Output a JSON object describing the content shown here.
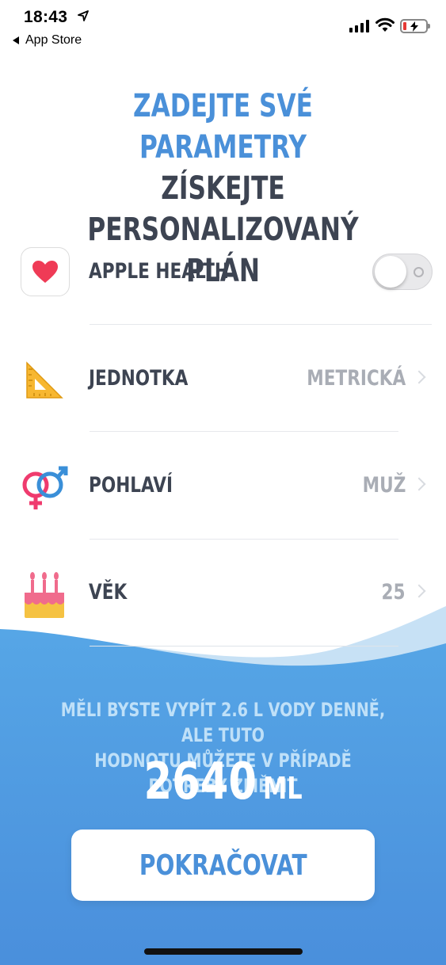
{
  "status_bar": {
    "time": "18:43",
    "back_label": "App Store",
    "icons": [
      "location-arrow-icon",
      "signal-icon",
      "wifi-icon",
      "battery-charging-icon"
    ]
  },
  "header": {
    "line1": "ZADEJTE SVÉ PARAMETRY",
    "line2": "ZÍSKEJTE PERSONALIZOVANÝ",
    "line3": "PLÁN"
  },
  "rows": [
    {
      "label": "APPLE HEALTH",
      "icon": "heart-icon",
      "toggle_on": false
    },
    {
      "label": "JEDNOTKA",
      "value": "METRICKÁ",
      "icon": "ruler-triangle-icon"
    },
    {
      "label": "POHLAVÍ",
      "value": "MUŽ",
      "icon": "gender-icon"
    },
    {
      "label": "VĚK",
      "value": "25",
      "icon": "cake-icon"
    }
  ],
  "recommendation": {
    "line1": "MĚLI BYSTE VYPÍT 2.6 L VODY DENNĚ, ALE TUTO",
    "line2": "HODNOTU MŮŽETE V PŘÍPADĚ POTŘEBY ZMĚNIT",
    "amount": "2640",
    "unit": "ML"
  },
  "cta": {
    "label": "POKRAČOVAT"
  },
  "colors": {
    "accent": "#4a90d9",
    "text": "#3d4452",
    "muted": "#a9adb5",
    "wave": "#4c9be0",
    "wave_light": "#c7e1f5"
  }
}
